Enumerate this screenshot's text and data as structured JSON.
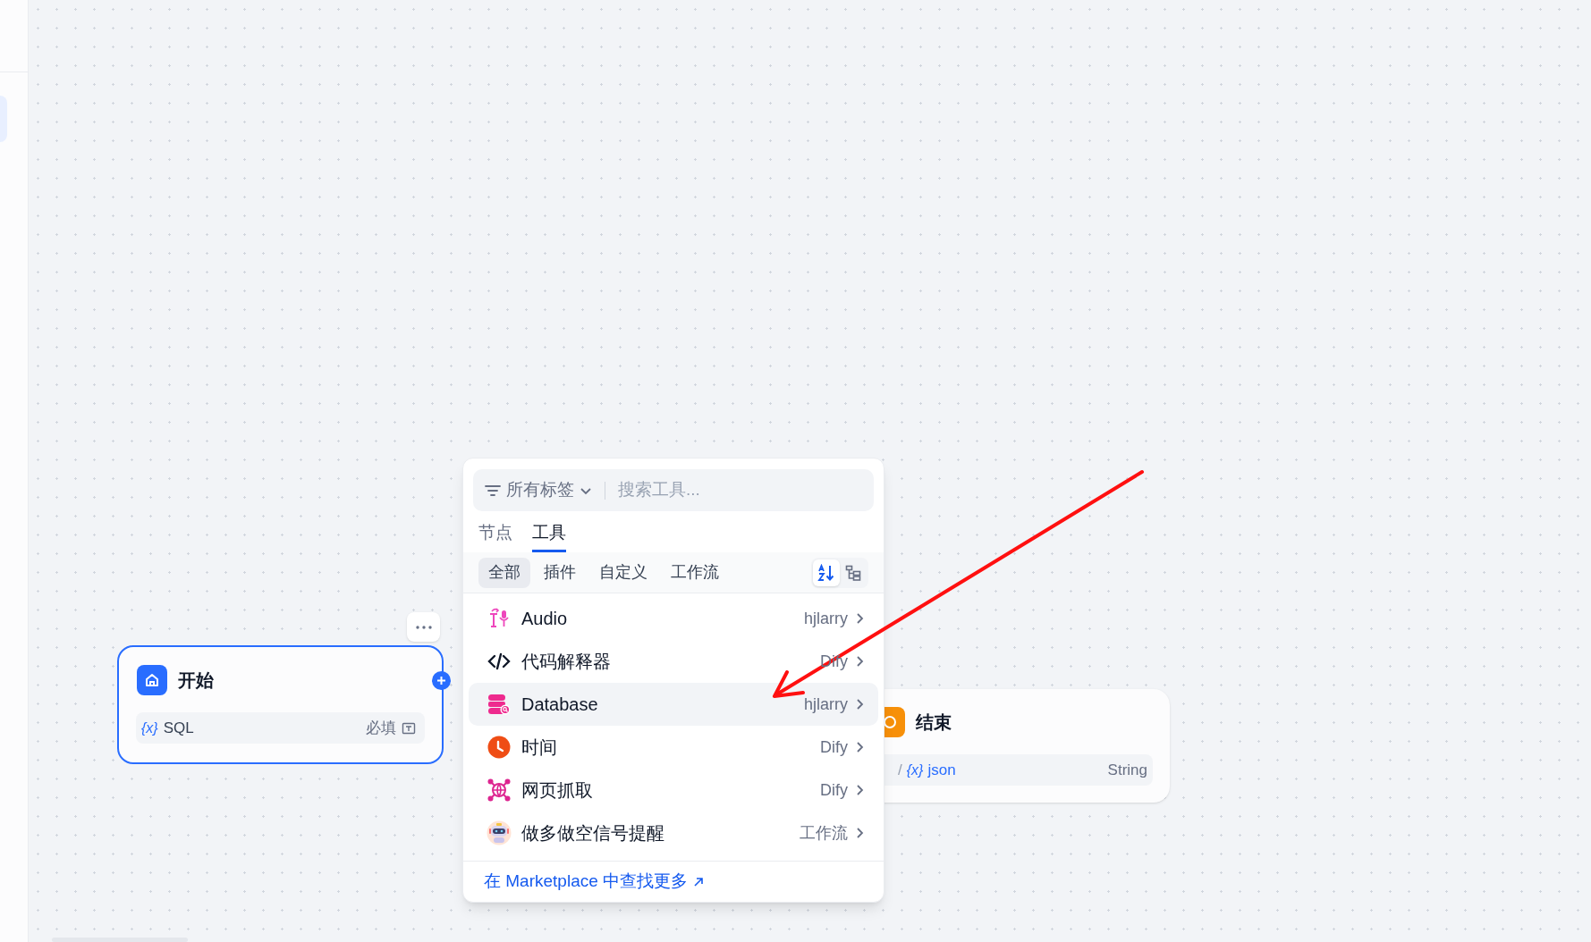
{
  "canvas": {
    "start_node": {
      "title": "开始",
      "selected": true,
      "variables": [
        {
          "icon_text": "{x}",
          "name": "SQL",
          "required_label": "必填"
        }
      ]
    },
    "end_node": {
      "title": "结束",
      "outputs": [
        {
          "separator": "/",
          "icon_text": "{x}",
          "name": "json",
          "type": "String"
        }
      ]
    }
  },
  "tool_picker": {
    "tag_filter": "所有标签",
    "search": {
      "placeholder": "搜索工具..."
    },
    "tabs": [
      {
        "label": "节点",
        "selected": false
      },
      {
        "label": "工具",
        "selected": true
      }
    ],
    "categories": [
      {
        "label": "全部",
        "selected": true
      },
      {
        "label": "插件",
        "selected": false
      },
      {
        "label": "自定义",
        "selected": false
      },
      {
        "label": "工作流",
        "selected": false
      }
    ],
    "view_modes": [
      {
        "kind": "sort",
        "selected": true
      },
      {
        "kind": "tree",
        "selected": false
      }
    ],
    "tools": [
      {
        "kind": "audio",
        "name": "Audio",
        "provider": "hjlarry",
        "selected": false
      },
      {
        "kind": "code",
        "name": "代码解释器",
        "provider": "Dify",
        "selected": false
      },
      {
        "kind": "database",
        "name": "Database",
        "provider": "hjlarry",
        "selected": true
      },
      {
        "kind": "clock",
        "name": "时间",
        "provider": "Dify",
        "selected": false
      },
      {
        "kind": "web",
        "name": "网页抓取",
        "provider": "Dify",
        "selected": false
      },
      {
        "kind": "robot",
        "name": "做多做空信号提醒",
        "provider": "工作流",
        "selected": false
      }
    ],
    "marketplace_link": "在 Marketplace 中查找更多"
  }
}
